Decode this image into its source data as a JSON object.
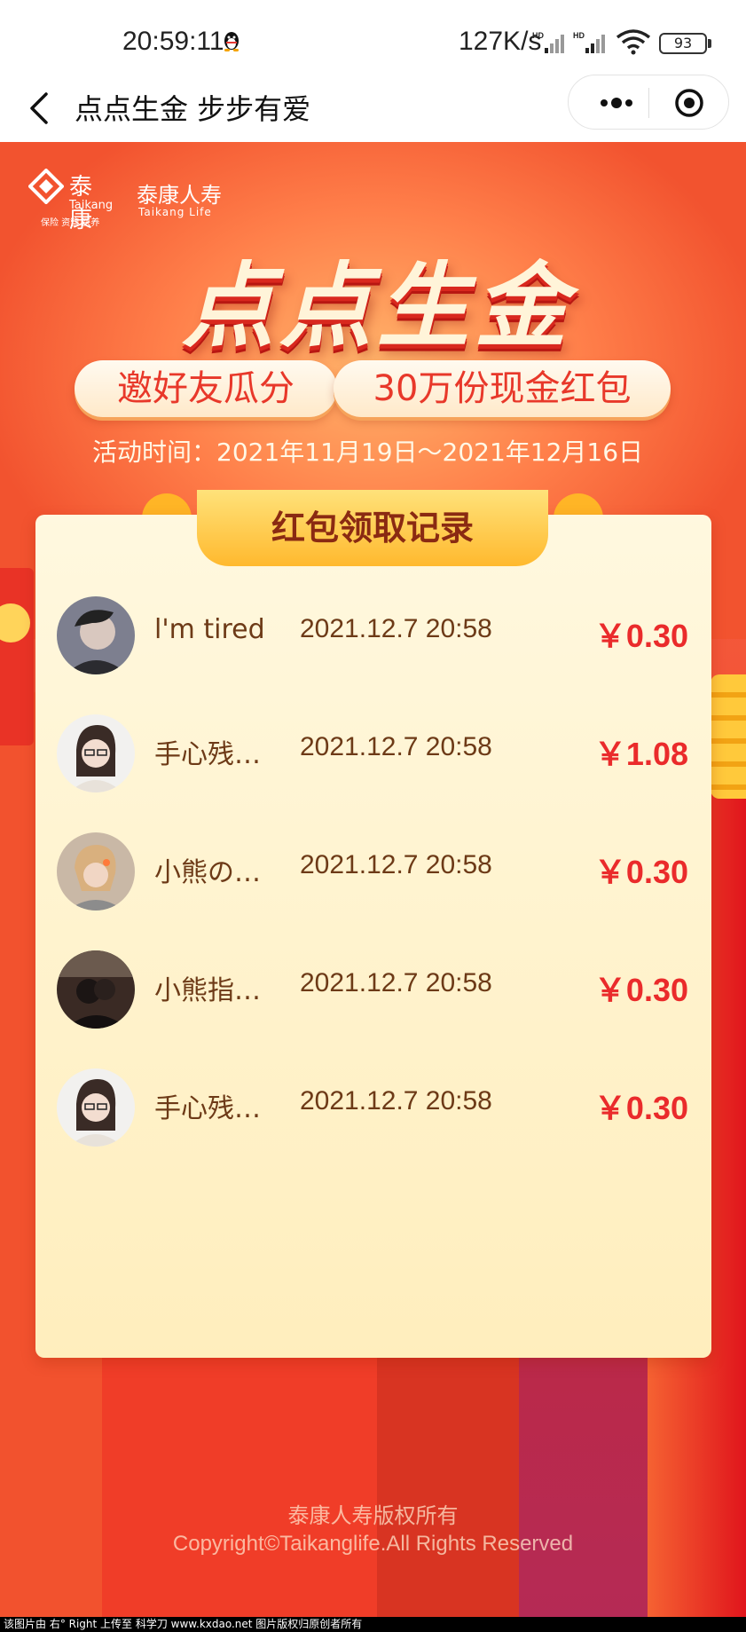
{
  "status_bar": {
    "time": "20:59:11",
    "speed": "127K/s",
    "battery": "93"
  },
  "nav": {
    "title": "点点生金 步步有爱"
  },
  "banner": {
    "brand_cn": "泰康",
    "brand_en": "Taikang",
    "brand_tagline": "保险 资管 医养",
    "brand2_cn": "泰康人寿",
    "brand2_en": "Taikang Life",
    "title": "点点生金",
    "pill_left": "邀好友瓜分",
    "pill_right": "30万份现金红包",
    "activity_time": "活动时间：2021年11月19日～2021年12月16日"
  },
  "records": {
    "title": "红包领取记录",
    "rows": [
      {
        "name": "l'm tired",
        "time": "2021.12.7 20:58",
        "amount": "￥0.30"
      },
      {
        "name": "手心残…",
        "time": "2021.12.7 20:58",
        "amount": "￥1.08"
      },
      {
        "name": "小熊の…",
        "time": "2021.12.7 20:58",
        "amount": "￥0.30"
      },
      {
        "name": "小熊指…",
        "time": "2021.12.7 20:58",
        "amount": "￥0.30"
      },
      {
        "name": "手心残…",
        "time": "2021.12.7 20:58",
        "amount": "￥0.30"
      }
    ]
  },
  "footer": {
    "copyright_cn": "泰康人寿版权所有",
    "copyright_en": "Copyright©Taikanglife.All Rights Reserved"
  },
  "watermark": "该图片由 右° Right 上传至 科学刀 www.kxdao.net 图片版权归原创者所有",
  "colors": {
    "accent_red": "#ea2b2b",
    "banner_orange": "#f4593b",
    "card_bg": "#fff3cf"
  }
}
